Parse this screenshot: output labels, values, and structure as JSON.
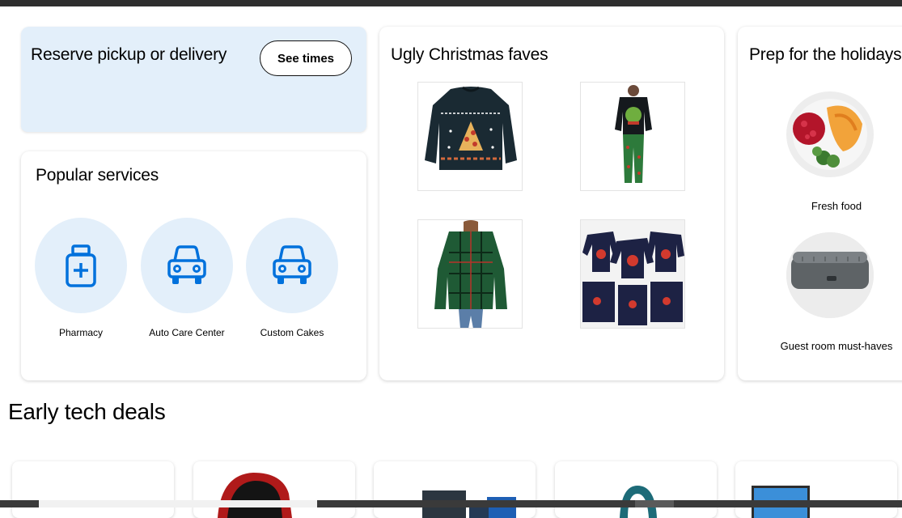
{
  "reserve": {
    "title": "Reserve pickup or delivery",
    "button_label": "See times"
  },
  "services": {
    "title": "Popular services",
    "items": [
      {
        "label": "Pharmacy",
        "icon": "pharmacy-bottle-icon"
      },
      {
        "label": "Auto Care Center",
        "icon": "car-icon"
      },
      {
        "label": "Custom Cakes",
        "icon": "car-icon"
      }
    ]
  },
  "ugly": {
    "title": "Ugly Christmas faves",
    "products": [
      {
        "name": "pizza-christmas-sweater"
      },
      {
        "name": "kids-christmas-pajamas"
      },
      {
        "name": "green-plaid-la-la-la-sweater"
      },
      {
        "name": "family-santa-pajamas"
      }
    ]
  },
  "prep": {
    "title": "Prep for the holidays",
    "items": [
      {
        "label": "Fresh food"
      },
      {
        "label": "Guest room must-haves"
      }
    ]
  },
  "tech": {
    "title": "Early tech deals"
  },
  "colors": {
    "accent_blue": "#0071dc",
    "light_blue": "#e3effa"
  }
}
